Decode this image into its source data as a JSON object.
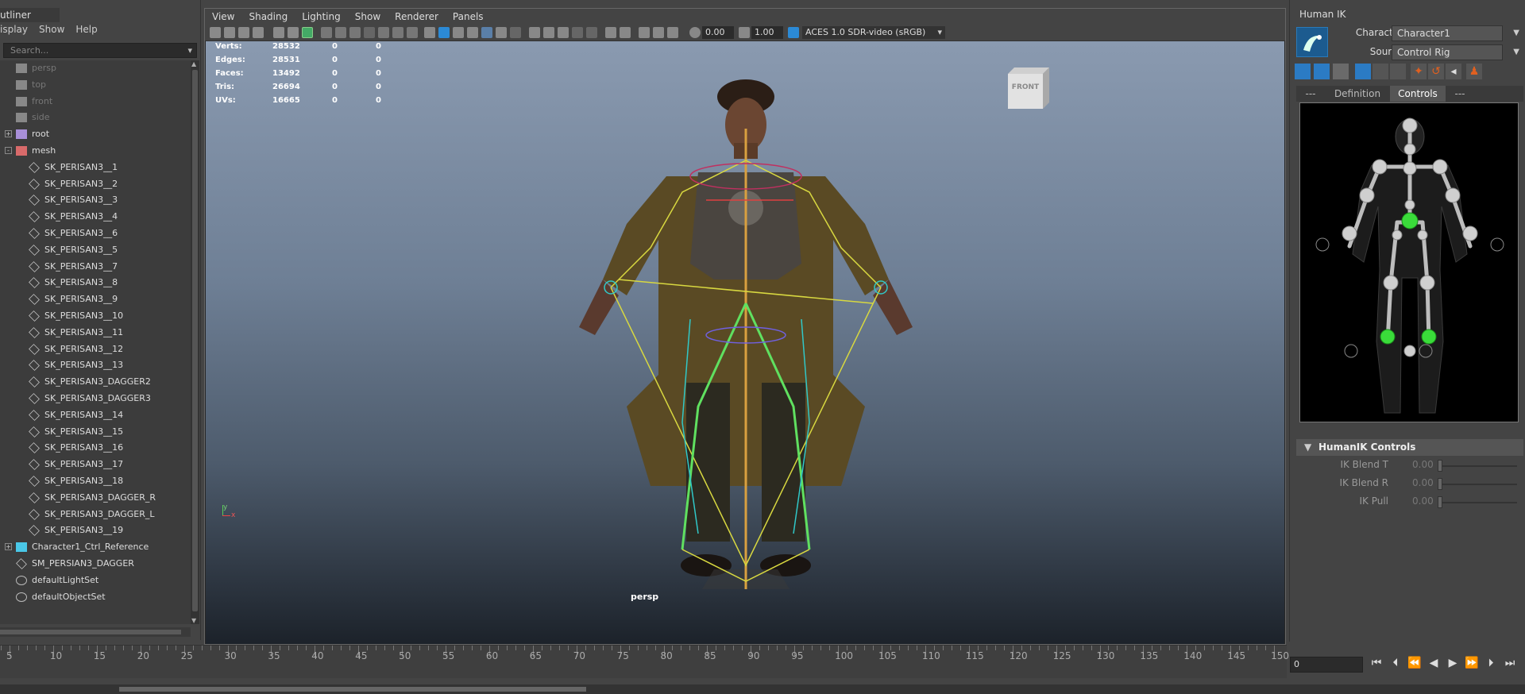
{
  "outliner": {
    "title": "utliner",
    "menu": [
      "isplay",
      "Show",
      "Help"
    ],
    "search_placeholder": "Search...",
    "items": [
      {
        "label": "persp",
        "indent": 1,
        "dim": true,
        "icon": "camera-icon",
        "expand": ""
      },
      {
        "label": "top",
        "indent": 1,
        "dim": true,
        "icon": "camera-icon",
        "expand": ""
      },
      {
        "label": "front",
        "indent": 1,
        "dim": true,
        "icon": "camera-icon",
        "expand": ""
      },
      {
        "label": "side",
        "indent": 1,
        "dim": true,
        "icon": "camera-icon",
        "expand": ""
      },
      {
        "label": "root",
        "indent": 1,
        "dim": false,
        "icon": "joint-icon",
        "expand": "+"
      },
      {
        "label": "mesh",
        "indent": 1,
        "dim": false,
        "icon": "mesh-icon",
        "expand": "-"
      },
      {
        "label": "SK_PERISAN3__1",
        "indent": 2,
        "dim": false,
        "icon": "shape-icon",
        "expand": ""
      },
      {
        "label": "SK_PERISAN3__2",
        "indent": 2,
        "dim": false,
        "icon": "shape-icon",
        "expand": ""
      },
      {
        "label": "SK_PERISAN3__3",
        "indent": 2,
        "dim": false,
        "icon": "shape-icon",
        "expand": ""
      },
      {
        "label": "SK_PERISAN3__4",
        "indent": 2,
        "dim": false,
        "icon": "shape-icon",
        "expand": ""
      },
      {
        "label": "SK_PERISAN3__6",
        "indent": 2,
        "dim": false,
        "icon": "shape-icon",
        "expand": ""
      },
      {
        "label": "SK_PERISAN3__5",
        "indent": 2,
        "dim": false,
        "icon": "shape-icon",
        "expand": ""
      },
      {
        "label": "SK_PERISAN3__7",
        "indent": 2,
        "dim": false,
        "icon": "shape-icon",
        "expand": ""
      },
      {
        "label": "SK_PERISAN3__8",
        "indent": 2,
        "dim": false,
        "icon": "shape-icon",
        "expand": ""
      },
      {
        "label": "SK_PERISAN3__9",
        "indent": 2,
        "dim": false,
        "icon": "shape-icon",
        "expand": ""
      },
      {
        "label": "SK_PERISAN3__10",
        "indent": 2,
        "dim": false,
        "icon": "shape-icon",
        "expand": ""
      },
      {
        "label": "SK_PERISAN3__11",
        "indent": 2,
        "dim": false,
        "icon": "shape-icon",
        "expand": ""
      },
      {
        "label": "SK_PERISAN3__12",
        "indent": 2,
        "dim": false,
        "icon": "shape-icon",
        "expand": ""
      },
      {
        "label": "SK_PERISAN3__13",
        "indent": 2,
        "dim": false,
        "icon": "shape-icon",
        "expand": ""
      },
      {
        "label": "SK_PERISAN3_DAGGER2",
        "indent": 2,
        "dim": false,
        "icon": "shape-icon",
        "expand": ""
      },
      {
        "label": "SK_PERISAN3_DAGGER3",
        "indent": 2,
        "dim": false,
        "icon": "shape-icon",
        "expand": ""
      },
      {
        "label": "SK_PERISAN3__14",
        "indent": 2,
        "dim": false,
        "icon": "shape-icon",
        "expand": ""
      },
      {
        "label": "SK_PERISAN3__15",
        "indent": 2,
        "dim": false,
        "icon": "shape-icon",
        "expand": ""
      },
      {
        "label": "SK_PERISAN3__16",
        "indent": 2,
        "dim": false,
        "icon": "shape-icon",
        "expand": ""
      },
      {
        "label": "SK_PERISAN3__17",
        "indent": 2,
        "dim": false,
        "icon": "shape-icon",
        "expand": ""
      },
      {
        "label": "SK_PERISAN3__18",
        "indent": 2,
        "dim": false,
        "icon": "shape-icon",
        "expand": ""
      },
      {
        "label": "SK_PERISAN3_DAGGER_R",
        "indent": 2,
        "dim": false,
        "icon": "shape-icon",
        "expand": ""
      },
      {
        "label": "SK_PERISAN3_DAGGER_L",
        "indent": 2,
        "dim": false,
        "icon": "shape-icon",
        "expand": ""
      },
      {
        "label": "SK_PERISAN3__19",
        "indent": 2,
        "dim": false,
        "icon": "shape-icon",
        "expand": ""
      },
      {
        "label": "Character1_Ctrl_Reference",
        "indent": 1,
        "dim": false,
        "icon": "hik-reference-icon",
        "expand": "+"
      },
      {
        "label": "SM_PERSIAN3_DAGGER",
        "indent": 1,
        "dim": false,
        "icon": "shape-icon",
        "expand": ""
      },
      {
        "label": "defaultLightSet",
        "indent": 1,
        "dim": false,
        "icon": "set-icon",
        "expand": ""
      },
      {
        "label": "defaultObjectSet",
        "indent": 1,
        "dim": false,
        "icon": "set-icon",
        "expand": ""
      }
    ]
  },
  "viewport": {
    "menus": [
      "View",
      "Shading",
      "Lighting",
      "Show",
      "Renderer",
      "Panels"
    ],
    "exposure": "0.00",
    "gamma": "1.00",
    "colorspace": "ACES 1.0 SDR-video (sRGB)",
    "camera_label": "persp",
    "view_cube_label": "FRONT",
    "stats": [
      {
        "label": "Verts:",
        "v1": "28532",
        "v2": "0",
        "v3": "0"
      },
      {
        "label": "Edges:",
        "v1": "28531",
        "v2": "0",
        "v3": "0"
      },
      {
        "label": "Faces:",
        "v1": "13492",
        "v2": "0",
        "v3": "0"
      },
      {
        "label": "Tris:",
        "v1": "26694",
        "v2": "0",
        "v3": "0"
      },
      {
        "label": "UVs:",
        "v1": "16665",
        "v2": "0",
        "v3": "0"
      }
    ],
    "axis_y": "y",
    "axis_x": "x"
  },
  "humanik": {
    "title": "Human IK",
    "character_label": "Character:",
    "character_value": "Character1",
    "source_label": "Source:",
    "source_value": "Control Rig",
    "tabs": [
      "---",
      "Definition",
      "Controls",
      "---"
    ],
    "active_tab": "Controls",
    "section_title": "HumanIK Controls",
    "controls": [
      {
        "label": "IK Blend T",
        "value": "0.00"
      },
      {
        "label": "IK Blend R",
        "value": "0.00"
      },
      {
        "label": "IK Pull",
        "value": "0.00"
      }
    ],
    "accent": "#4dd84d"
  },
  "timeline": {
    "ticks": [
      "5",
      "10",
      "15",
      "20",
      "25",
      "30",
      "35",
      "40",
      "45",
      "50",
      "55",
      "60",
      "65",
      "70",
      "75",
      "80",
      "85",
      "90",
      "95",
      "100",
      "105",
      "110",
      "115",
      "120",
      "125",
      "130",
      "135",
      "140",
      "145",
      "150"
    ],
    "current_frame": "0"
  }
}
